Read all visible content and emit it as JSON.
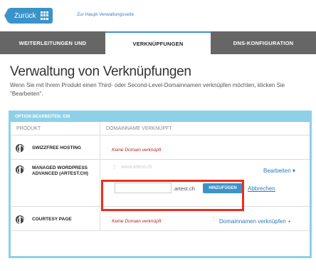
{
  "topbar": {
    "back_label": "Zurück",
    "home_link": "Zur Haupt-Verwaltungsseite"
  },
  "tabs": [
    {
      "label": "WEITERLEITUNGEN UND",
      "active": false
    },
    {
      "label": "VERKNÜPFUNGEN",
      "active": true
    },
    {
      "label": "DNS-KONFIGURATION",
      "active": false
    }
  ],
  "header": {
    "title": "Verwaltung von Verknüpfungen",
    "description": "Wenn Sie mit Ihrem Produkt einen Third- oder Second-Level-Domainnamen verknüpfen möchten, klicken Sie \"Bearbeiten\"."
  },
  "panel": {
    "title": "OPTION BEARBEITEN: EIN",
    "columns": [
      "PRODUKT",
      "DOMAINNAME VERKNÜPFT"
    ]
  },
  "rows": [
    {
      "product": "SWIZZFREE HOSTING",
      "domain": "Keine Domain verknüpft"
    },
    {
      "product": "MANAGED WORDPRESS ADVANCED (ARTEST.CH)",
      "ghost": "www.artest.ch",
      "action": "Bearbeiten ▾",
      "input_value": "",
      "suffix": ".artest.ch",
      "add_label": "HINZUFÜGEN",
      "cancel_label": "Abbrechen"
    },
    {
      "product": "COURTESY PAGE",
      "domain": "Keine Domain verknüpft",
      "action": "Domainnamen verknüpfen +"
    }
  ],
  "colors": {
    "accent": "#3a93c9",
    "panel_border": "#8ed0e8",
    "highlight": "#e8301e",
    "no_domain": "#b22222"
  }
}
